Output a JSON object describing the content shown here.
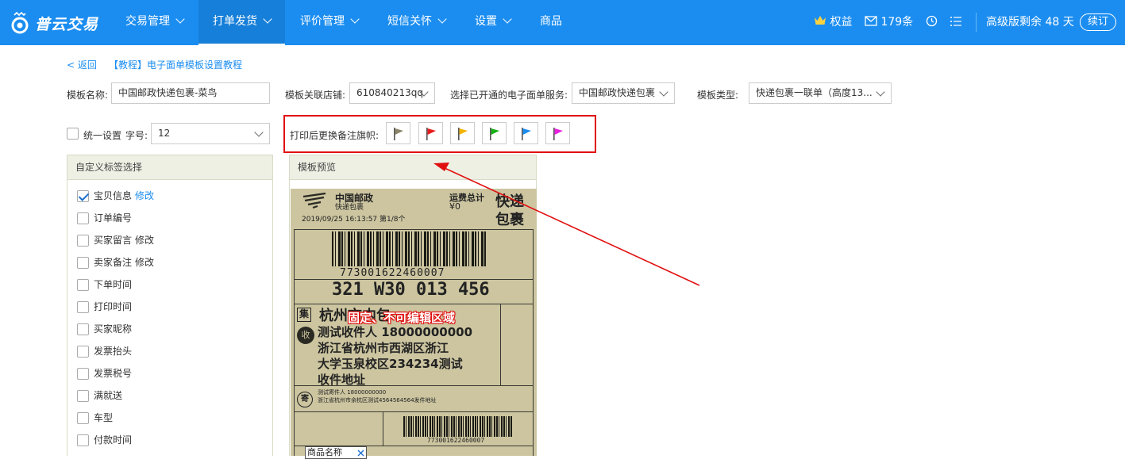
{
  "header": {
    "logo_text": "普云交易",
    "nav": [
      {
        "label": "交易管理"
      },
      {
        "label": "打单发货"
      },
      {
        "label": "评价管理"
      },
      {
        "label": "短信关怀"
      },
      {
        "label": "设置"
      },
      {
        "label": "商品"
      }
    ],
    "rights_label": "权益",
    "messages_label": "179条",
    "plan_text": "高级版剩余 48 天",
    "renew_label": "续订"
  },
  "breadcrumb": {
    "back_label": "< 返回",
    "tutorial_label": "【教程】电子面单模板设置教程"
  },
  "form": {
    "template_name_label": "模板名称:",
    "template_name_value": "中国邮政快递包裹-菜鸟",
    "shop_label": "模板关联店铺:",
    "shop_value": "610840213qq",
    "service_label": "选择已开通的电子面单服务:",
    "service_value": "中国邮政快递包裹",
    "type_label": "模板类型:",
    "type_value": "快递包裹一联单（高度13...",
    "unify_label": "统一设置",
    "fontsize_label": "字号:",
    "fontsize_value": "12",
    "flag_label": "打印后更换备注旗帜:"
  },
  "flags": [
    {
      "name": "gray",
      "color": "#8a8468"
    },
    {
      "name": "red",
      "color": "#e61c1c"
    },
    {
      "name": "yellow",
      "color": "#f0b400"
    },
    {
      "name": "green",
      "color": "#19b019"
    },
    {
      "name": "blue",
      "color": "#1b8df0"
    },
    {
      "name": "purple",
      "color": "#e91ee0"
    }
  ],
  "tag_panel": {
    "title": "自定义标签选择",
    "edit_label": "修改",
    "items": [
      {
        "label": "宝贝信息",
        "checked": true
      },
      {
        "label": "订单编号",
        "checked": false
      },
      {
        "label": "买家留言",
        "checked": false
      },
      {
        "label": "卖家备注",
        "checked": false
      },
      {
        "label": "下单时间",
        "checked": false
      },
      {
        "label": "打印时间",
        "checked": false
      },
      {
        "label": "买家昵称",
        "checked": false
      },
      {
        "label": "发票抬头",
        "checked": false
      },
      {
        "label": "发票税号",
        "checked": false
      },
      {
        "label": "满就送",
        "checked": false
      },
      {
        "label": "车型",
        "checked": false
      },
      {
        "label": "付款时间",
        "checked": false
      }
    ]
  },
  "preview": {
    "title": "模板预览",
    "carrier_cn": "中国邮政",
    "carrier_sub": "快递包裹",
    "freight_label": "运费总计",
    "freight_value": "¥0",
    "big_title_1": "快递",
    "big_title_2": "包裹",
    "datetime": "2019/09/25  16:13:57  第1/8个",
    "barcode_number": "773001622460007",
    "sort_code": "321 W30 013 456",
    "ji_label": "集",
    "dest": "杭州市内包",
    "recv_icon": "收",
    "recv_line": "测试收件人  18000000000",
    "addr_1": "浙江省杭州市西湖区浙江",
    "addr_2": "大学玉泉校区234234测试",
    "addr_3": "收件地址",
    "send_icon": "寄",
    "sender_line": "测试寄件人  18000000000",
    "sender_addr": "浙江省杭州市余杭区测试4564564564发件地址",
    "barcode_small": "773001622460007",
    "product_label": "商品名称",
    "annotation": "固定、不可编辑区域"
  },
  "colors": {
    "brand": "#1b8df0",
    "highlight": "#e01010",
    "label_bg": "#ccc5a0"
  }
}
